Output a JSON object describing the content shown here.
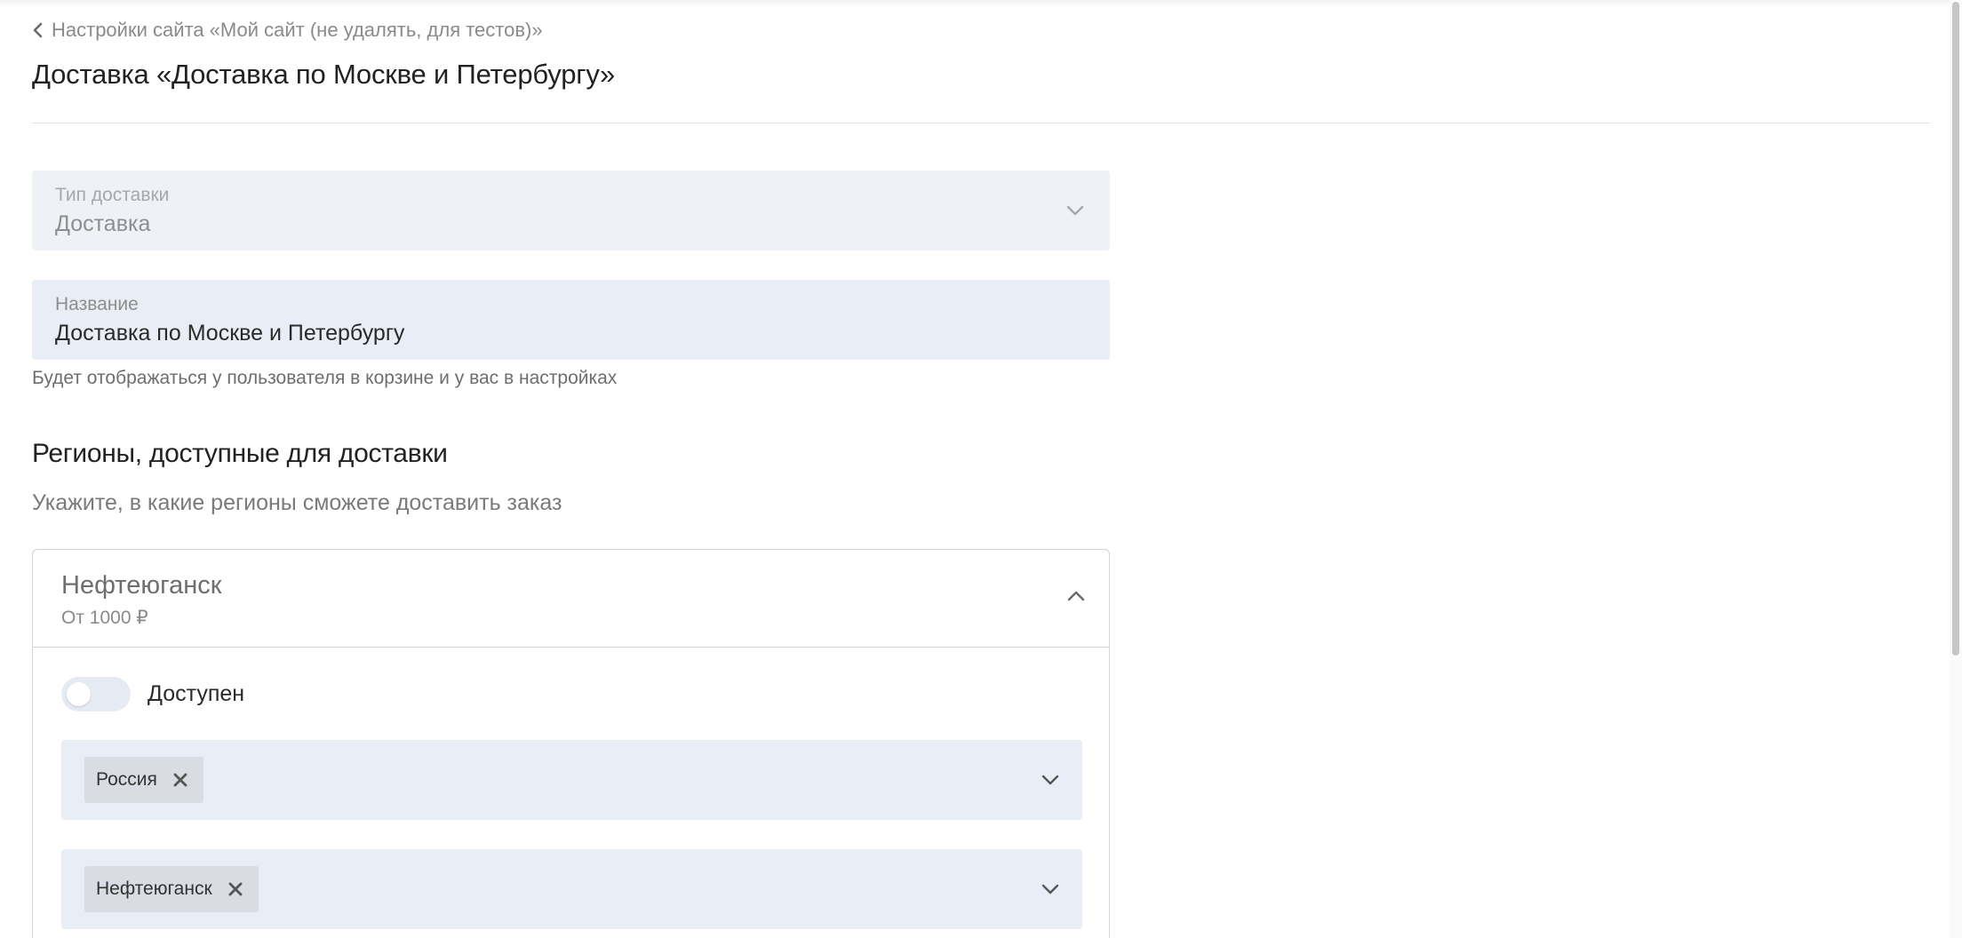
{
  "breadcrumb": {
    "label": "Настройки сайта «Мой сайт (не удалять, для тестов)»",
    "icon": "chevron-left-icon"
  },
  "title": "Доставка «Доставка по Москве и Петербургу»",
  "delivery_type": {
    "label": "Тип доставки",
    "value": "Доставка",
    "disabled": true,
    "icon": "chevron-down-icon"
  },
  "name_field": {
    "label": "Название",
    "value": "Доставка по Москве и Петербургу",
    "hint": "Будет отображаться у пользователя в корзине и у вас в настройках"
  },
  "regions": {
    "title": "Регионы, доступные для доставки",
    "subtitle": "Укажите, в какие регионы сможете доставить заказ",
    "card": {
      "name": "Нефтеюганск",
      "price": "От 1000 ₽",
      "expanded": true,
      "toggle": {
        "label": "Доступен",
        "on": false
      },
      "country_select": {
        "tags": [
          "Россия"
        ]
      },
      "city_select": {
        "tags": [
          "Нефтеюганск"
        ]
      }
    }
  },
  "colors": {
    "field_bg": "#e9edf5",
    "tag_bg": "#d9dce2",
    "text_primary": "#222222",
    "text_muted": "#8a8a8a"
  }
}
